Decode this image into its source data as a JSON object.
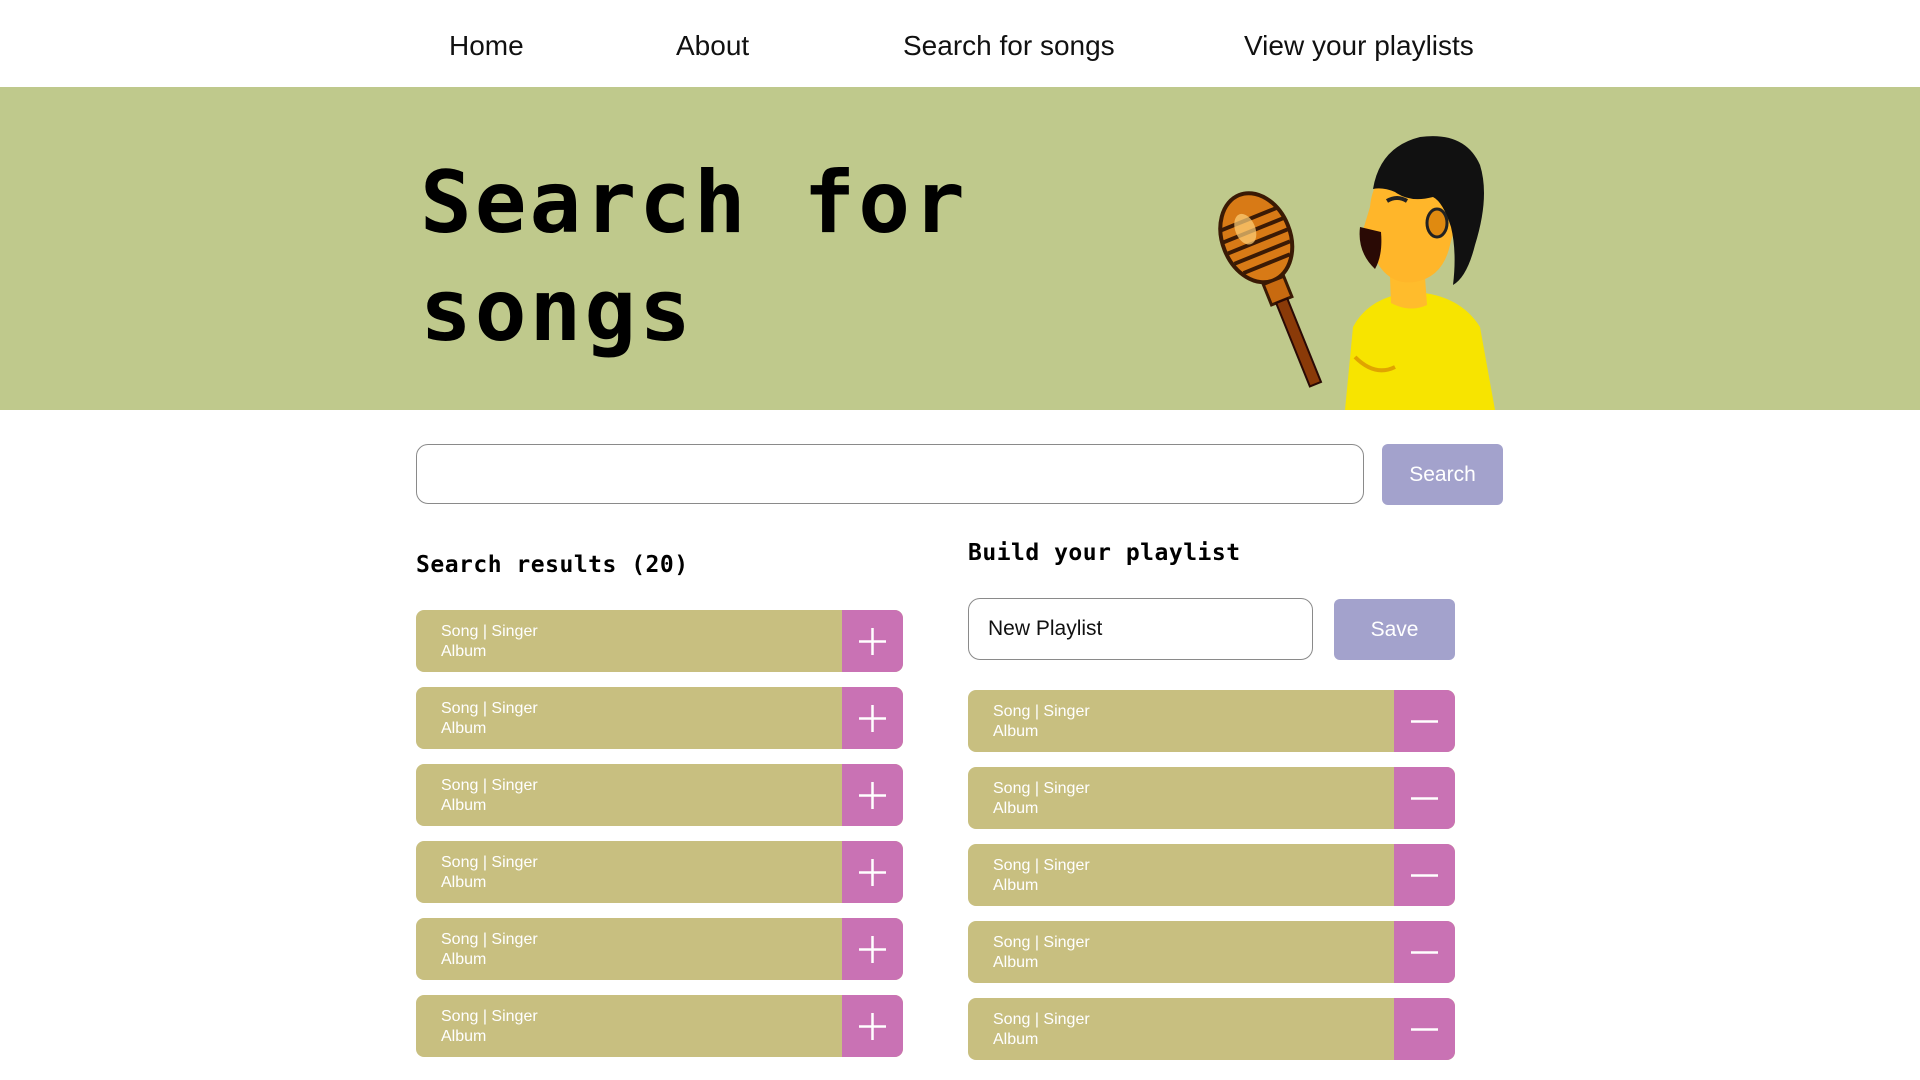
{
  "nav": {
    "items": [
      "Home",
      "About",
      "Search for songs",
      "View your playlists"
    ]
  },
  "hero": {
    "title": "Search for songs",
    "image": "singer-with-microphone-illustration"
  },
  "search": {
    "value": "",
    "placeholder": "",
    "button_label": "Search"
  },
  "results": {
    "heading": "Search results (20)",
    "items": [
      {
        "line1": "Song | Singer",
        "line2": "Album",
        "action_icon": "plus-icon"
      },
      {
        "line1": "Song | Singer",
        "line2": "Album",
        "action_icon": "plus-icon"
      },
      {
        "line1": "Song | Singer",
        "line2": "Album",
        "action_icon": "plus-icon"
      },
      {
        "line1": "Song | Singer",
        "line2": "Album",
        "action_icon": "plus-icon"
      },
      {
        "line1": "Song | Singer",
        "line2": "Album",
        "action_icon": "plus-icon"
      },
      {
        "line1": "Song | Singer",
        "line2": "Album",
        "action_icon": "plus-icon"
      }
    ]
  },
  "playlist": {
    "heading": "Build your playlist",
    "name_value": "New Playlist",
    "save_label": "Save",
    "items": [
      {
        "line1": "Song | Singer",
        "line2": "Album",
        "action_icon": "minus-icon"
      },
      {
        "line1": "Song | Singer",
        "line2": "Album",
        "action_icon": "minus-icon"
      },
      {
        "line1": "Song | Singer",
        "line2": "Album",
        "action_icon": "minus-icon"
      },
      {
        "line1": "Song | Singer",
        "line2": "Album",
        "action_icon": "minus-icon"
      },
      {
        "line1": "Song | Singer",
        "line2": "Album",
        "action_icon": "minus-icon"
      }
    ]
  },
  "colors": {
    "hero_bg": "#bfc98c",
    "row_bg": "#c8bf80",
    "row_action": "#c972b4",
    "button": "#a3a2cc"
  }
}
